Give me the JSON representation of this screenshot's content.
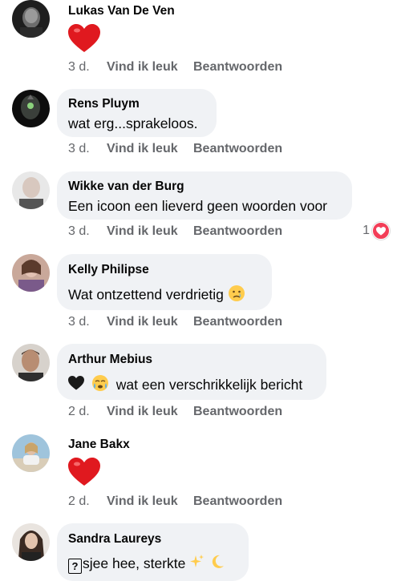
{
  "comments": [
    {
      "author": "Lukas Van De Ven",
      "text": "",
      "emoji": "red-heart-icon",
      "time": "3 d.",
      "like": "Vind ik leuk",
      "reply": "Beantwoorden"
    },
    {
      "author": "Rens Pluym",
      "text": "wat erg...sprakeloos.",
      "time": "3 d.",
      "like": "Vind ik leuk",
      "reply": "Beantwoorden"
    },
    {
      "author": "Wikke van der Burg",
      "text": "Een icoon een lieverd geen woorden voor",
      "time": "3 d.",
      "like": "Vind ik leuk",
      "reply": "Beantwoorden",
      "reaction_count": "1",
      "reaction_icon": "heart-reaction-icon"
    },
    {
      "author": "Kelly Philipse",
      "text": "Wat ontzettend verdrietig",
      "emoji_after": "crying-face-icon",
      "time": "3 d.",
      "like": "Vind ik leuk",
      "reply": "Beantwoorden"
    },
    {
      "author": "Arthur Mebius",
      "text": "wat een verschrikkelijk bericht",
      "emoji_before": [
        "black-heart-icon",
        "crying-face-icon"
      ],
      "time": "2 d.",
      "like": "Vind ik leuk",
      "reply": "Beantwoorden"
    },
    {
      "author": "Jane Bakx",
      "text": "",
      "emoji": "red-heart-icon",
      "time": "2 d.",
      "like": "Vind ik leuk",
      "reply": "Beantwoorden"
    },
    {
      "author": "Sandra Laureys",
      "text": "sjee hee, sterkte",
      "prefix_glyph": "?",
      "emoji_after": [
        "sparkles-icon",
        "crescent-moon-icon"
      ]
    }
  ],
  "colors": {
    "bubble": "#f0f2f5",
    "meta": "#65676b",
    "heart": "#f33e58"
  }
}
